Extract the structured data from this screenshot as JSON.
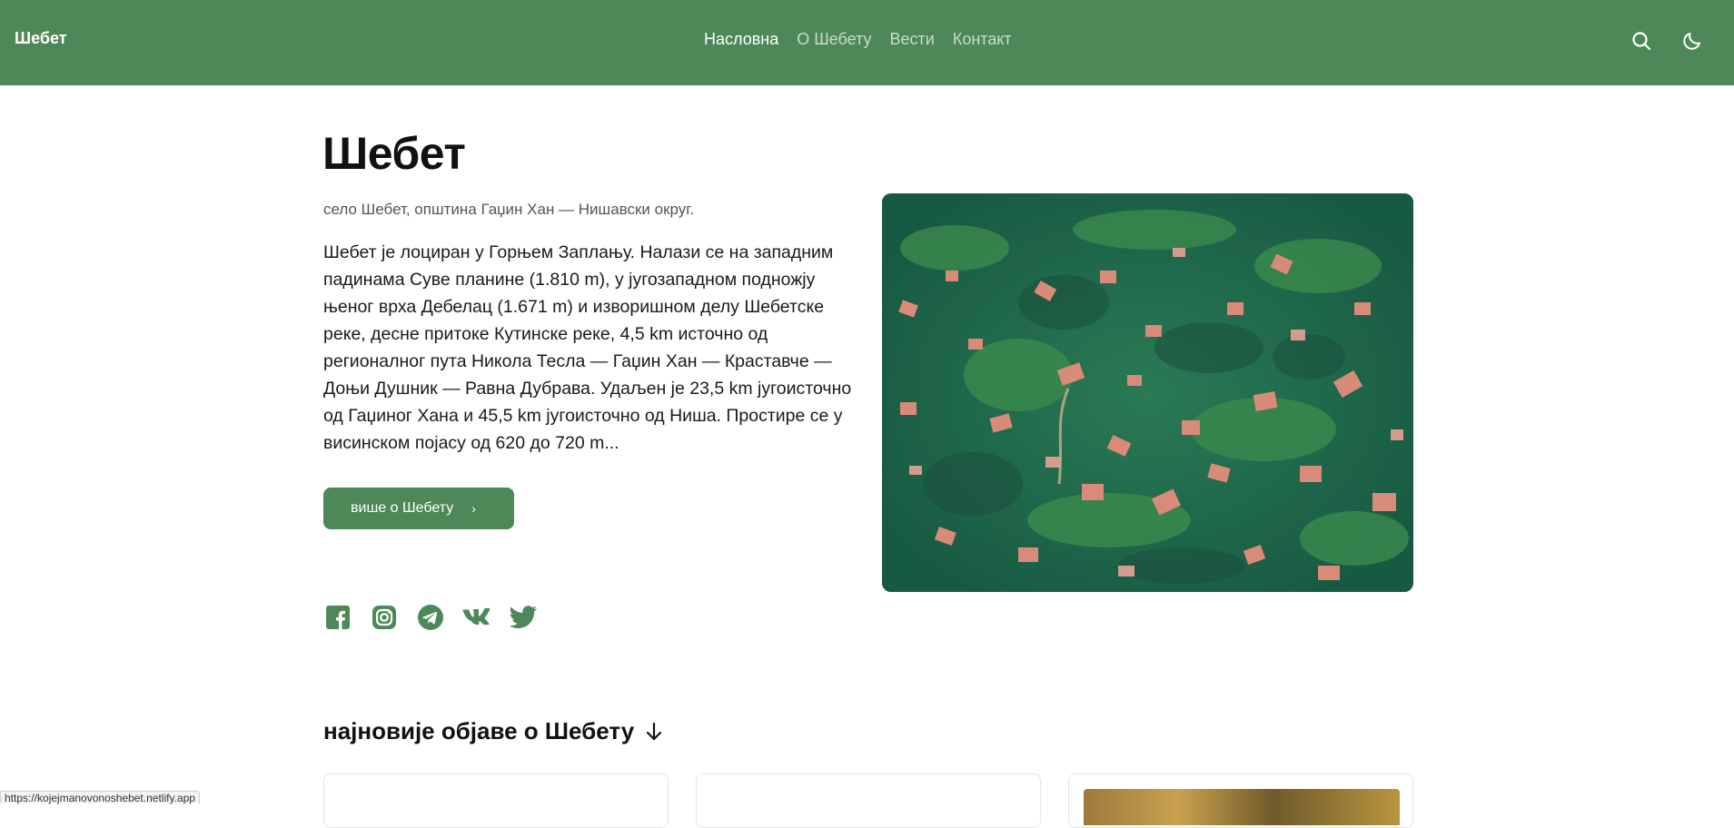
{
  "header": {
    "brand": "Шебет",
    "nav": [
      {
        "label": "Насловна",
        "active": true
      },
      {
        "label": "О Шебету",
        "active": false
      },
      {
        "label": "Вести",
        "active": false
      },
      {
        "label": "Контакт",
        "active": false
      }
    ],
    "icons": [
      "search-icon",
      "moon-icon"
    ],
    "background_color": "#4e8858"
  },
  "hero": {
    "title": "Шебет",
    "subtitle": "село Шебет, општина Гаџин Хан — Нишавски округ.",
    "description": "Шебет је лоциран у Горњем Заплању. Налази се на западним падинама Суве планине (1.810 m), у југозападном подножју њеног врха Дебелац (1.671 m) и изворишном делу Шебетске реке, десне притоке Кутинске реке, 4,5 km источно од регионалног пута Никола Тесла — Гаџин Хан — Краставче — Доњи Душник — Равна Дубрава. Удаљен је 23,5 km југоисточно од Гаџиног Хана и 45,5 km југоисточно од Ниша. Простире се у висинском појасу од 620 до 720 m...",
    "more_button": "више о Шебету",
    "more_icon": "chevron-right-icon"
  },
  "social": [
    "facebook-icon",
    "instagram-icon",
    "telegram-icon",
    "vk-icon",
    "twitter-icon"
  ],
  "latest": {
    "title": "најновије објаве о Шебету",
    "icon": "arrow-down-icon"
  },
  "status_bar": {
    "url": "https://kojejmanovonoshebet.netlify.app"
  },
  "accent_color": "#4e8858"
}
